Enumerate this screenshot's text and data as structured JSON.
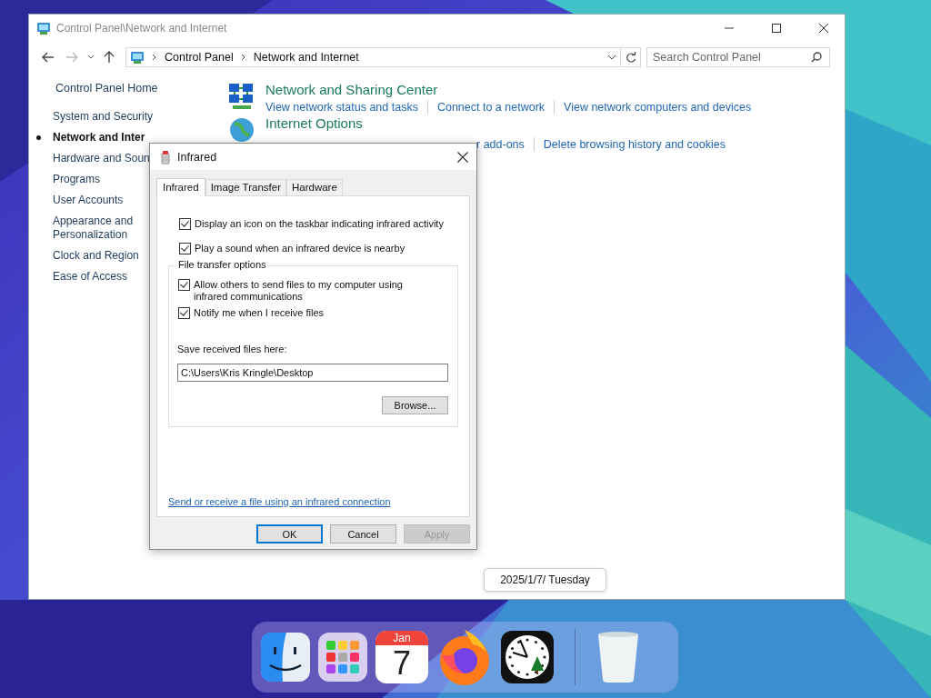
{
  "window": {
    "title": "Control Panel\\Network and Internet",
    "breadcrumb": [
      "Control Panel",
      "Network and Internet"
    ],
    "search": {
      "placeholder": "Search Control Panel"
    }
  },
  "sidebar": {
    "home": "Control Panel Home",
    "items": [
      {
        "label": "System and Security",
        "selected": false
      },
      {
        "label": "Network and Inter",
        "selected": true
      },
      {
        "label": "Hardware and Soun",
        "selected": false
      },
      {
        "label": "Programs",
        "selected": false
      },
      {
        "label": "User Accounts",
        "selected": false
      },
      {
        "label": "Appearance and Personalization",
        "selected": false
      },
      {
        "label": "Clock and Region",
        "selected": false
      },
      {
        "label": "Ease of Access",
        "selected": false
      }
    ]
  },
  "categories": [
    {
      "kind": "network",
      "title": "Network and Sharing Center",
      "links": [
        "View network status and tasks",
        "Connect to a network",
        "View network computers and devices"
      ]
    },
    {
      "kind": "globe",
      "title": "Internet Options",
      "links": [
        "r add-ons",
        "Delete browsing history and cookies"
      ]
    }
  ],
  "dialog": {
    "title": "Infrared",
    "tabs": [
      {
        "label": "Infrared",
        "selected": true
      },
      {
        "label": "Image Transfer",
        "selected": false
      },
      {
        "label": "Hardware",
        "selected": false
      }
    ],
    "options": [
      {
        "label": "Display an icon on the taskbar indicating infrared activity",
        "checked": true
      },
      {
        "label": "Play a sound when an infrared device is nearby",
        "checked": true
      }
    ],
    "group": {
      "title": "File transfer options",
      "options": [
        {
          "label": "Allow others to send files to my computer using infrared communications",
          "checked": true
        },
        {
          "label": "Notify me when I receive files",
          "checked": true
        }
      ],
      "save_label": "Save received files here:",
      "path": "C:\\Users\\Kris Kringle\\Desktop",
      "browse": "Browse..."
    },
    "link": "Send or receive a file using an infrared connection",
    "buttons": [
      {
        "label": "OK",
        "default": true,
        "disabled": false
      },
      {
        "label": "Cancel",
        "default": false,
        "disabled": false
      },
      {
        "label": "Apply",
        "default": false,
        "disabled": true
      }
    ]
  },
  "tooltip": "2025/1/7/ Tuesday",
  "dock": {
    "apps": [
      {
        "kind": "finder"
      },
      {
        "kind": "launchpad"
      },
      {
        "kind": "calendar",
        "month": "Jan",
        "day": "7"
      },
      {
        "kind": "firefox"
      },
      {
        "kind": "clock"
      },
      {
        "kind": "trash"
      }
    ]
  }
}
